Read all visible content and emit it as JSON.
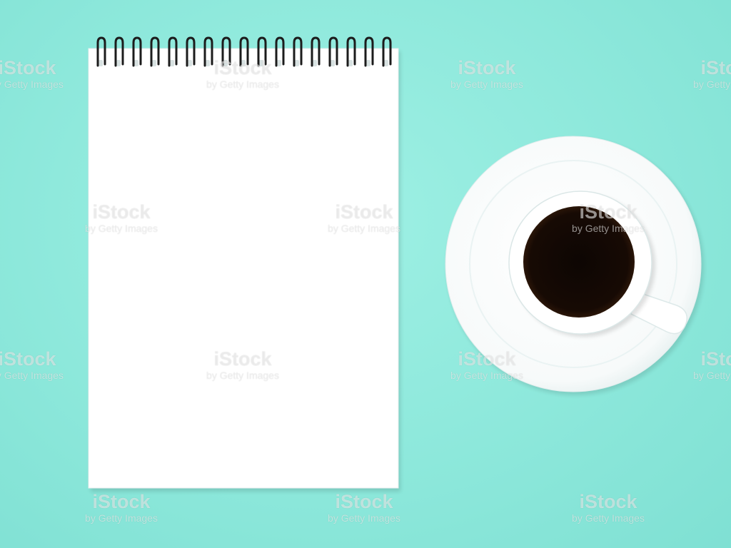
{
  "colors": {
    "background": "#8ee9dc",
    "notepad_paper": "#ffffff",
    "spiral_wire": "#1c1c1c",
    "saucer": "#ffffff",
    "cup": "#ffffff",
    "coffee": "#1a0d06"
  },
  "objects": {
    "notepad": "spiral-notepad",
    "cup": "coffee-cup",
    "saucer": "saucer"
  },
  "watermark": {
    "brand": "iStock",
    "byline": "by Getty Images"
  }
}
